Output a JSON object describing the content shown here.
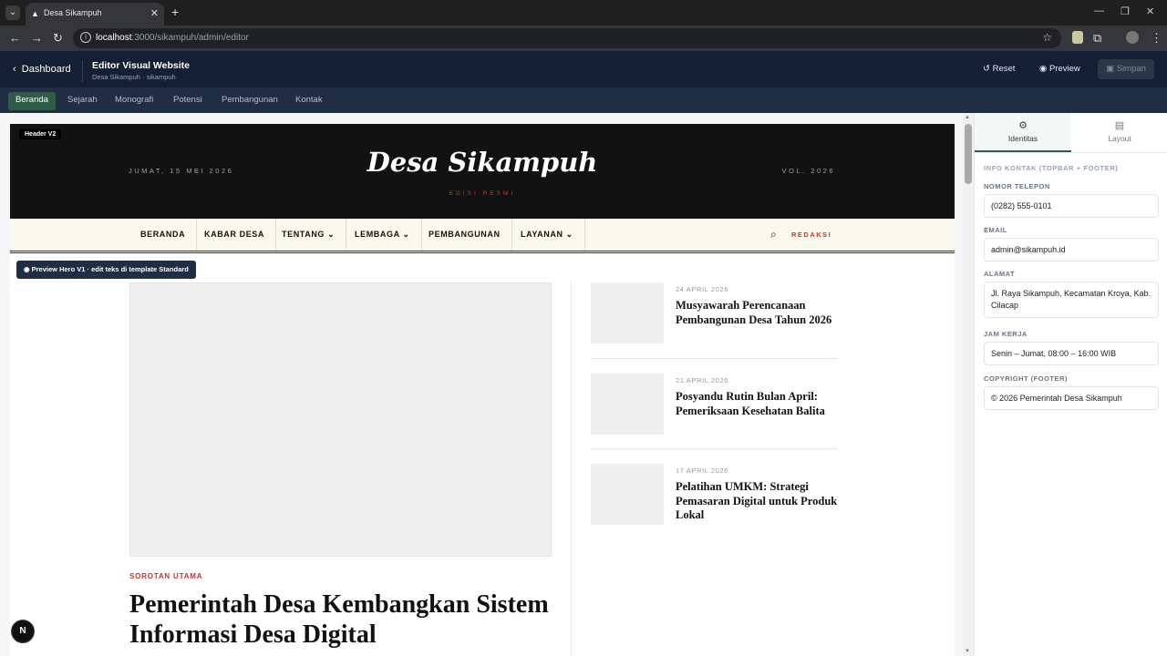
{
  "browser": {
    "tab_title": "Desa Sikampuh",
    "url_host": "localhost",
    "url_path": ":3000/sikampuh/admin/editor"
  },
  "app": {
    "back_label": "Dashboard",
    "title": "Editor Visual Website",
    "subtitle": "Desa Sikampuh · sikampuh",
    "reset_label": "Reset",
    "preview_label": "Preview",
    "save_label": "Simpan"
  },
  "page_tabs": [
    {
      "label": "Beranda",
      "active": true
    },
    {
      "label": "Sejarah"
    },
    {
      "label": "Monografi"
    },
    {
      "label": "Potensi"
    },
    {
      "label": "Pembangunan"
    },
    {
      "label": "Kontak"
    }
  ],
  "site_header": {
    "badge": "Header V2",
    "date": "JUMAT, 15 MEI 2026",
    "title": "Desa Sikampuh",
    "edition": "EDISI RESMI",
    "volume": "VOL. 2026"
  },
  "site_nav": {
    "items": [
      "BERANDA",
      "KABAR DESA",
      "TENTANG",
      "LEMBAGA",
      "PEMBANGUNAN",
      "LAYANAN"
    ],
    "redaksi": "REDAKSI"
  },
  "hero": {
    "preview_pill": "Preview Hero V1 · edit teks di template Standard",
    "kicker": "SOROTAN UTAMA",
    "headline": "Pemerintah Desa Kembangkan Sistem Informasi Desa Digital"
  },
  "stories": [
    {
      "date": "24 APRIL 2026",
      "title": "Musyawarah Perencanaan Pembangunan Desa Tahun 2026"
    },
    {
      "date": "21 APRIL 2026",
      "title": "Posyandu Rutin Bulan April: Pemeriksaan Kesehatan Balita"
    },
    {
      "date": "17 APRIL 2026",
      "title": "Pelatihan UMKM: Strategi Pemasaran Digital untuk Produk Lokal"
    }
  ],
  "sidebar": {
    "tab_identity": "Identitas",
    "tab_layout": "Layout",
    "section_heading": "INFO KONTAK (TOPBAR + FOOTER)",
    "phone_label": "NOMOR TELEPON",
    "phone_value": "(0282) 555-0101",
    "email_label": "EMAIL",
    "email_value": "admin@sikampuh.id",
    "address_label": "ALAMAT",
    "address_value": "Jl. Raya Sikampuh, Kecamatan Kroya, Kab. Cilacap",
    "hours_label": "JAM KERJA",
    "hours_value": "Senin – Jumat, 08:00 – 16:00 WIB",
    "copyright_label": "COPYRIGHT (FOOTER)",
    "copyright_value": "© 2026 Pemerintah Desa Sikampuh"
  },
  "dev_badge": "N"
}
